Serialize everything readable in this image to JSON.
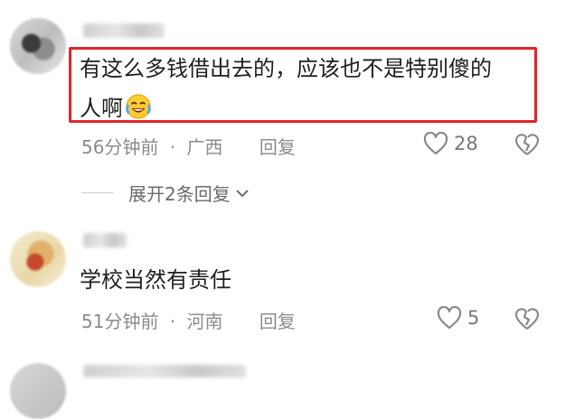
{
  "comments": [
    {
      "text_line1": "有这么多钱借出去的，应该也不是特别傻的",
      "text_line2": "人啊",
      "emoji": "rofl-emoji",
      "time": "56分钟前",
      "sep": "·",
      "location": "广西",
      "reply_label": "回复",
      "likes": "28"
    },
    {
      "text": "学校当然有责任",
      "time": "51分钟前",
      "sep": "·",
      "location": "河南",
      "reply_label": "回复",
      "likes": "5"
    }
  ],
  "expand_replies_label": "展开2条回复",
  "colors": {
    "highlight": "#e0242b",
    "meta": "#8b8b8b"
  }
}
